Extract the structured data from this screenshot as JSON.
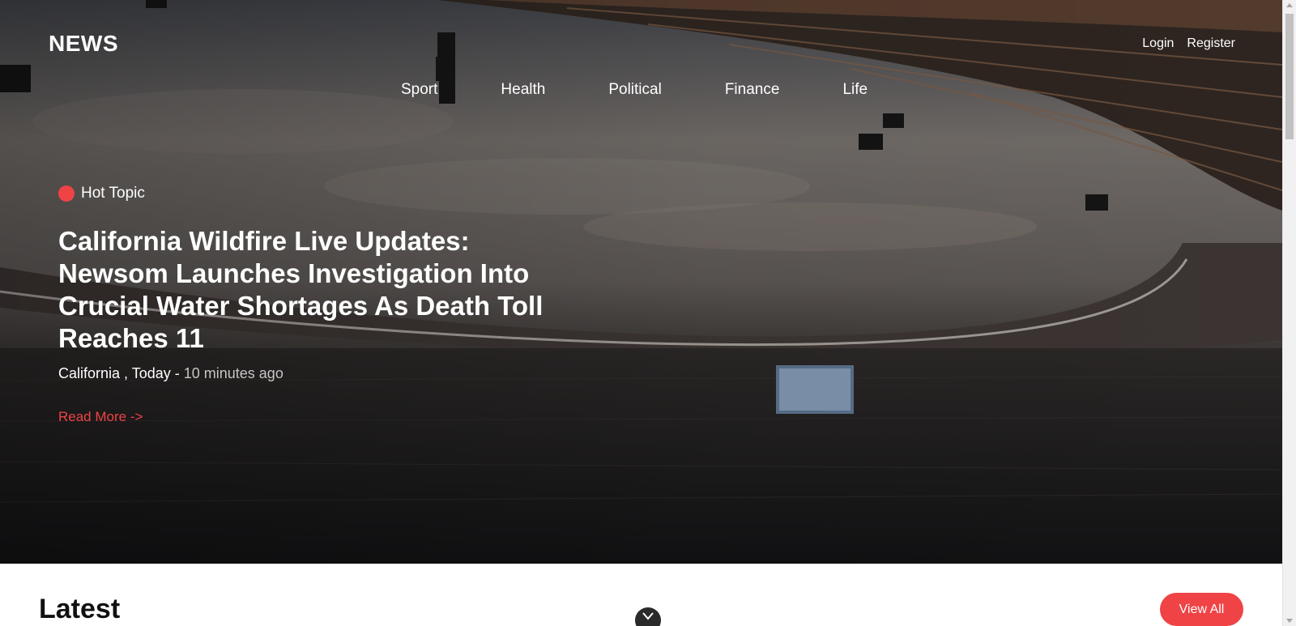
{
  "brand": {
    "logo": "NEWS"
  },
  "auth": {
    "login": "Login",
    "register": "Register"
  },
  "nav": {
    "items": [
      "Sport",
      "Health",
      "Political",
      "Finance",
      "Life"
    ]
  },
  "hero": {
    "badge": "Hot Topic",
    "headline": "California Wildfire Live Updates: Newsom Launches Investigation Into Crucial Water Shortages As Death Toll Reaches 11",
    "location": "California , Today",
    "separator": " - ",
    "time_ago": "10 minutes ago",
    "read_more": "Read More ->"
  },
  "latest": {
    "title": "Latest",
    "view_all": "View All",
    "scroll_icon": "chevron-down-icon"
  },
  "colors": {
    "accent": "#ef4346",
    "hero_text": "#ffffff",
    "muted_text": "#c5c5c5"
  }
}
